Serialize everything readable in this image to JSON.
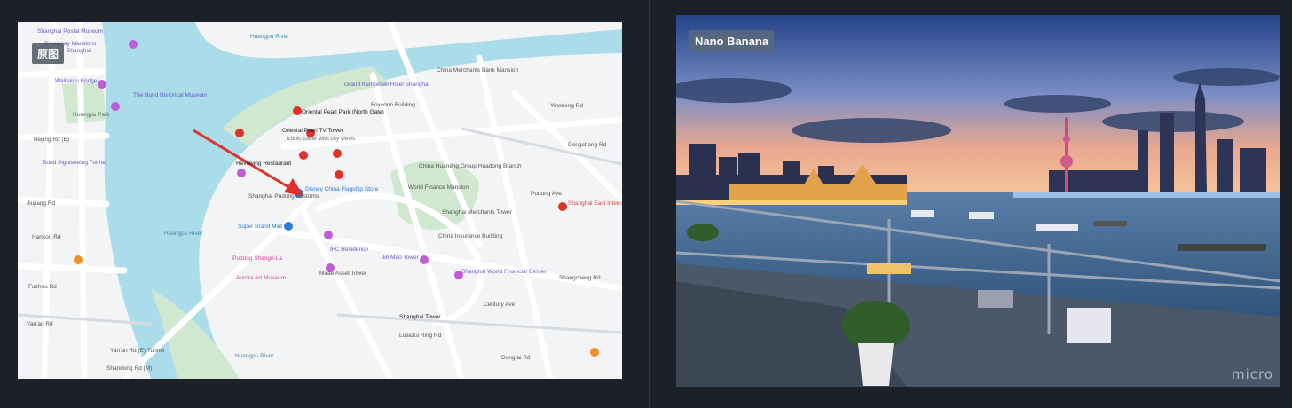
{
  "left_panel": {
    "badge": "原图",
    "map_labels": [
      {
        "id": "postal-museum",
        "text": "Shanghai Postal Museum",
        "color": "#6a5cc7"
      },
      {
        "id": "broadway-mansions",
        "text": "Broadway Mansions",
        "color": "#6a5cc7"
      },
      {
        "id": "broadway-shanghai",
        "text": "Shanghai",
        "color": "#6a5cc7"
      },
      {
        "id": "waibaidu-bridge",
        "text": "Waibaidu Bridge",
        "color": "#6a5cc7"
      },
      {
        "id": "bund-museum",
        "text": "The Bund Historical Museum",
        "color": "#6a5cc7"
      },
      {
        "id": "huangpu-park",
        "text": "Huangpu Park",
        "color": "#4a7a5a"
      },
      {
        "id": "beijing-rd",
        "text": "Beijing Rd (E)",
        "color": "#555555"
      },
      {
        "id": "bund-tunnel",
        "text": "Bund Sightseeing Tunnel",
        "color": "#6a5cc7"
      },
      {
        "id": "jiujiang-rd",
        "text": "Jiujiang Rd",
        "color": "#555555"
      },
      {
        "id": "hankou-rd",
        "text": "Hankou Rd",
        "color": "#555555"
      },
      {
        "id": "fuzhou-rd",
        "text": "Fuzhou Rd",
        "color": "#555555"
      },
      {
        "id": "yan-an-rd",
        "text": "Yan'an Rd",
        "color": "#555555"
      },
      {
        "id": "huangpu-river-top",
        "text": "Huangpu River",
        "color": "#4a8aa8"
      },
      {
        "id": "huangpu-river-mid",
        "text": "Huangpu River",
        "color": "#4a8aa8"
      },
      {
        "id": "huangpu-river-bot",
        "text": "Huangpu River",
        "color": "#4a8aa8"
      },
      {
        "id": "grand-kempinski",
        "text": "Grand Kempinski Hotel Shanghai",
        "color": "#6a5cc7"
      },
      {
        "id": "oriental-pearl-park",
        "text": "Oriental Pearl Park (North Gate)",
        "color": "#222222"
      },
      {
        "id": "oriental-pearl-tower",
        "text": "Oriental Pearl TV Tower",
        "color": "#222222"
      },
      {
        "id": "oriental-pearl-sub",
        "text": "iconic tower with city views",
        "color": "#777777"
      },
      {
        "id": "revolving-restaurant",
        "text": "Revolving Restaurant",
        "color": "#222222"
      },
      {
        "id": "disney-store",
        "text": "Disney China Flagship Store",
        "color": "#2b7bd6"
      },
      {
        "id": "pudong-customs",
        "text": "Shanghai Pudong Customs",
        "color": "#555555"
      },
      {
        "id": "super-brand-mall",
        "text": "Super Brand Mall",
        "color": "#2b7bd6"
      },
      {
        "id": "foxconn-building",
        "text": "Foxconn Building",
        "color": "#555555"
      },
      {
        "id": "china-merchants-bank",
        "text": "China Merchants Bank Mansion",
        "color": "#555555"
      },
      {
        "id": "china-huaneng",
        "text": "China Huaneng Group Huadong Branch",
        "color": "#555555"
      },
      {
        "id": "world-finance-mansion",
        "text": "World Finance Mansion",
        "color": "#555555"
      },
      {
        "id": "merchants-tower",
        "text": "Shanghai Merchants Tower",
        "color": "#555555"
      },
      {
        "id": "china-insurance",
        "text": "China Insurance Building",
        "color": "#555555"
      },
      {
        "id": "shanghai-east-medical",
        "text": "Shanghai East International Medical",
        "color": "#d14a4a"
      },
      {
        "id": "pudong-shangri-la",
        "text": "Pudong Shangri-La",
        "color": "#d14a9a"
      },
      {
        "id": "aurora-art-museum",
        "text": "Aurora Art Museum",
        "color": "#d14a9a"
      },
      {
        "id": "ifc-residence",
        "text": "IFC Residence",
        "color": "#6a5cc7"
      },
      {
        "id": "mirae-asset-tower",
        "text": "Mirae Asset Tower",
        "color": "#555555"
      },
      {
        "id": "jin-mao-tower",
        "text": "Jin Mao Tower",
        "color": "#6a5cc7"
      },
      {
        "id": "swfc",
        "text": "Shanghai World Financial Center",
        "color": "#6a5cc7"
      },
      {
        "id": "shanghai-tower",
        "text": "Shanghai Tower",
        "color": "#222222"
      },
      {
        "id": "yincheng-rd",
        "text": "Yincheng Rd",
        "color": "#555555"
      },
      {
        "id": "pudong-ave",
        "text": "Pudong Ave",
        "color": "#555555"
      },
      {
        "id": "dongchang-rd",
        "text": "Dongchang Rd",
        "color": "#555555"
      },
      {
        "id": "lujiazui-ring-rd",
        "text": "Lujiazui Ring Rd",
        "color": "#555555"
      },
      {
        "id": "century-ave",
        "text": "Century Ave",
        "color": "#555555"
      },
      {
        "id": "yanan-tunnel",
        "text": "Yan'an Rd (E) Tunnel",
        "color": "#555555"
      },
      {
        "id": "shangcheng-rd",
        "text": "Shangcheng Rd",
        "color": "#555555"
      },
      {
        "id": "dongtai-rd",
        "text": "Dongtai Rd",
        "color": "#555555"
      },
      {
        "id": "shandong-rd",
        "text": "Shandong Rd (M)",
        "color": "#555555"
      }
    ],
    "colors": {
      "river": "#aadcea",
      "park": "#cfe8cf",
      "road": "#ffffff",
      "arrow": "#e0312b"
    }
  },
  "right_panel": {
    "badge": "Nano Banana",
    "watermark": "micro",
    "colors": {
      "sky_top": "#24438a",
      "sky_mid": "#7b8ec5",
      "horizon": "#e9a890",
      "water": "#20456e"
    }
  }
}
